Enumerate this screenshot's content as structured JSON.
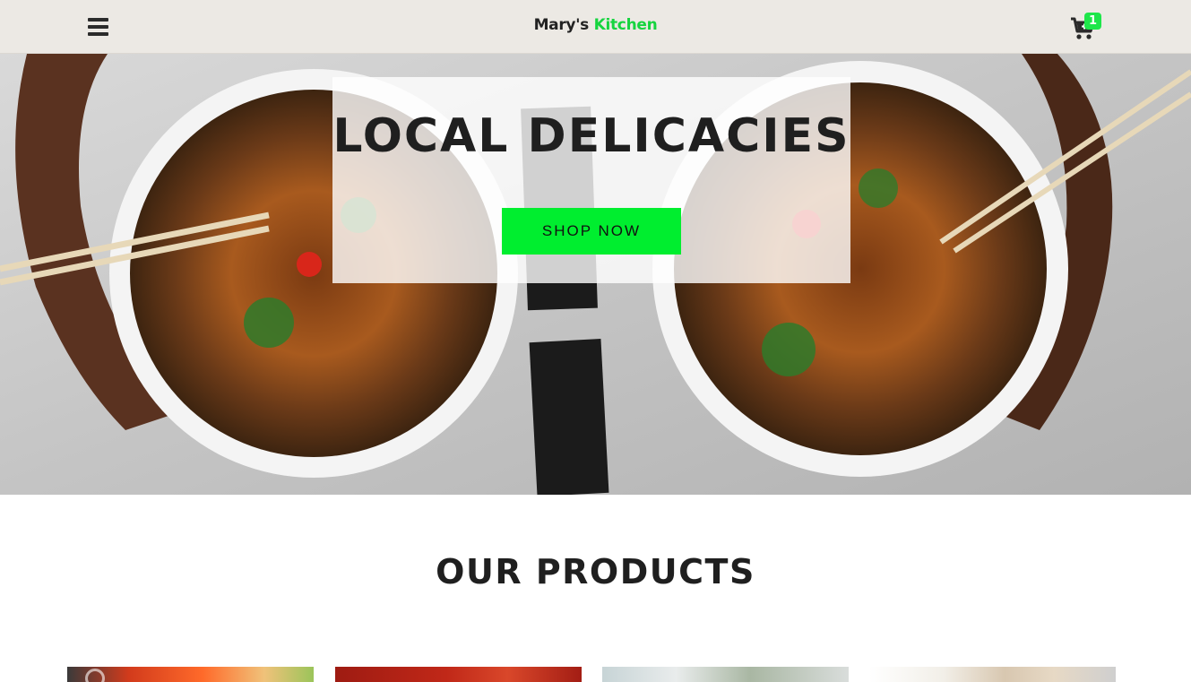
{
  "navbar": {
    "brand_first": "Mary's",
    "brand_accent": "Kitchen",
    "cart_count": "1",
    "menu_icon": "hamburger-icon",
    "cart_icon": "shopping-cart-icon",
    "accent_color": "#16d43f"
  },
  "hero": {
    "title": "LOCAL DELICACIES",
    "cta_label": "SHOP NOW",
    "cta_color": "#00ee2f"
  },
  "products": {
    "heading": "OUR PRODUCTS"
  }
}
